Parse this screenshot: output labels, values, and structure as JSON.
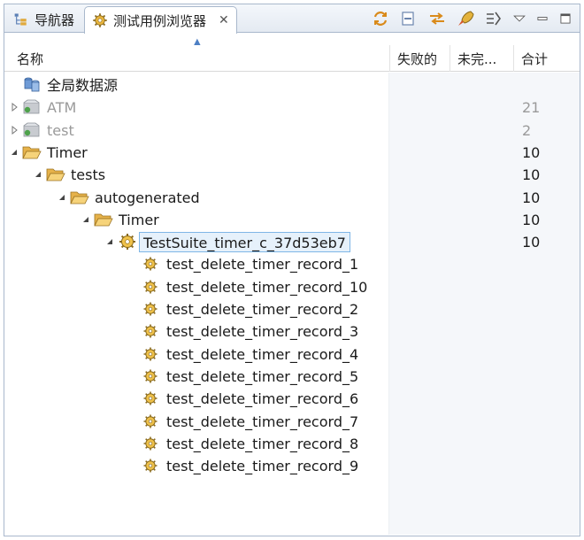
{
  "tabs": [
    {
      "label": "导航器",
      "icon": "navigator-tree-icon",
      "active": false
    },
    {
      "label": "测试用例浏览器",
      "icon": "gear-icon",
      "active": true
    }
  ],
  "toolbar_icons": [
    "refresh-icon",
    "collapse-all-icon",
    "link-editor-icon",
    "rocket-icon",
    "filter-icon",
    "view-menu-icon",
    "minimize-icon",
    "maximize-icon"
  ],
  "columns": {
    "name": "名称",
    "failed": "失败的",
    "unfinished": "未完...",
    "total": "合计"
  },
  "tree": [
    {
      "label": "全局数据源",
      "depth": 0,
      "icon": "data-source-icon",
      "twisty": "none",
      "total": "",
      "muted": false,
      "selected": false
    },
    {
      "label": "ATM",
      "depth": 0,
      "icon": "project-icon",
      "twisty": "collapsed",
      "total": "21",
      "muted": true,
      "selected": false
    },
    {
      "label": "test",
      "depth": 0,
      "icon": "project-icon",
      "twisty": "collapsed",
      "total": "2",
      "muted": true,
      "selected": false
    },
    {
      "label": "Timer",
      "depth": 0,
      "icon": "folder-open-icon",
      "twisty": "expanded",
      "total": "10",
      "muted": false,
      "selected": false
    },
    {
      "label": "tests",
      "depth": 1,
      "icon": "folder-open-icon",
      "twisty": "expanded",
      "total": "10",
      "muted": false,
      "selected": false
    },
    {
      "label": "autogenerated",
      "depth": 2,
      "icon": "folder-open-icon",
      "twisty": "expanded",
      "total": "10",
      "muted": false,
      "selected": false
    },
    {
      "label": "Timer",
      "depth": 3,
      "icon": "folder-open-icon",
      "twisty": "expanded",
      "total": "10",
      "muted": false,
      "selected": false
    },
    {
      "label": "TestSuite_timer_c_37d53eb7",
      "depth": 4,
      "icon": "test-suite-gear-icon",
      "twisty": "expanded",
      "total": "10",
      "muted": false,
      "selected": true
    },
    {
      "label": "test_delete_timer_record_1",
      "depth": 5,
      "icon": "test-case-gear-icon",
      "twisty": "none",
      "total": "",
      "muted": false,
      "selected": false
    },
    {
      "label": "test_delete_timer_record_10",
      "depth": 5,
      "icon": "test-case-gear-icon",
      "twisty": "none",
      "total": "",
      "muted": false,
      "selected": false
    },
    {
      "label": "test_delete_timer_record_2",
      "depth": 5,
      "icon": "test-case-gear-icon",
      "twisty": "none",
      "total": "",
      "muted": false,
      "selected": false
    },
    {
      "label": "test_delete_timer_record_3",
      "depth": 5,
      "icon": "test-case-gear-icon",
      "twisty": "none",
      "total": "",
      "muted": false,
      "selected": false
    },
    {
      "label": "test_delete_timer_record_4",
      "depth": 5,
      "icon": "test-case-gear-icon",
      "twisty": "none",
      "total": "",
      "muted": false,
      "selected": false
    },
    {
      "label": "test_delete_timer_record_5",
      "depth": 5,
      "icon": "test-case-gear-icon",
      "twisty": "none",
      "total": "",
      "muted": false,
      "selected": false
    },
    {
      "label": "test_delete_timer_record_6",
      "depth": 5,
      "icon": "test-case-gear-icon",
      "twisty": "none",
      "total": "",
      "muted": false,
      "selected": false
    },
    {
      "label": "test_delete_timer_record_7",
      "depth": 5,
      "icon": "test-case-gear-icon",
      "twisty": "none",
      "total": "",
      "muted": false,
      "selected": false
    },
    {
      "label": "test_delete_timer_record_8",
      "depth": 5,
      "icon": "test-case-gear-icon",
      "twisty": "none",
      "total": "",
      "muted": false,
      "selected": false
    },
    {
      "label": "test_delete_timer_record_9",
      "depth": 5,
      "icon": "test-case-gear-icon",
      "twisty": "none",
      "total": "",
      "muted": false,
      "selected": false
    }
  ]
}
